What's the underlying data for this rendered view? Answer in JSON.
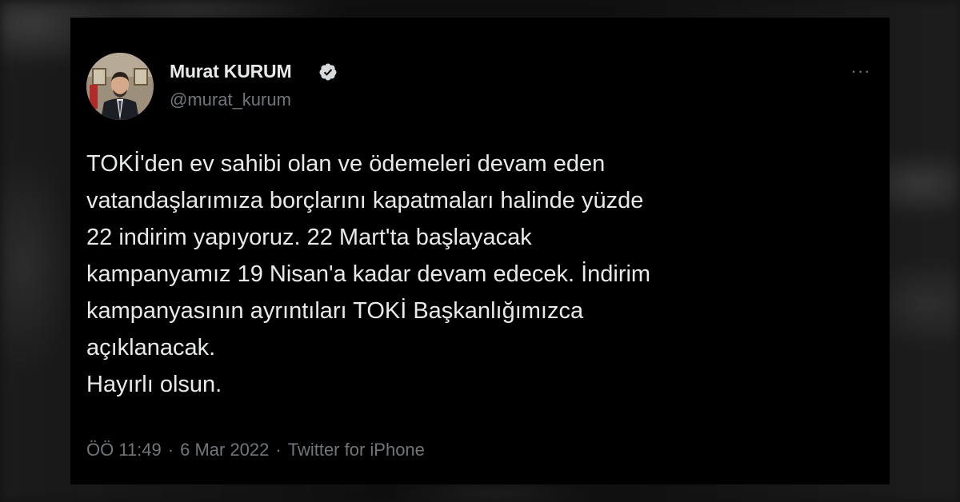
{
  "tweet": {
    "author": {
      "display_name": "Murat KURUM",
      "handle": "@murat_kurum",
      "verified": true,
      "verified_icon": "verified-badge-icon"
    },
    "more_icon": "···",
    "text": "TOKİ'den ev sahibi olan ve ödemeleri devam eden\nvatandaşlarımıza borçlarını kapatmaları halinde yüzde\n22 indirim yapıyoruz. 22 Mart'ta başlayacak\nkampanyamız 19 Nisan'a kadar devam edecek. İndirim\nkampanyasının ayrıntıları TOKİ Başkanlığımızca\naçıklanacak.\nHayırlı olsun.",
    "time": "ÖÖ 11:49",
    "date": "6 Mar 2022",
    "source": "Twitter for iPhone",
    "separator": "·"
  },
  "colors": {
    "background": "#000000",
    "text_primary": "#e7e9ea",
    "text_secondary": "#71767b",
    "verified": "#d6d9db"
  }
}
